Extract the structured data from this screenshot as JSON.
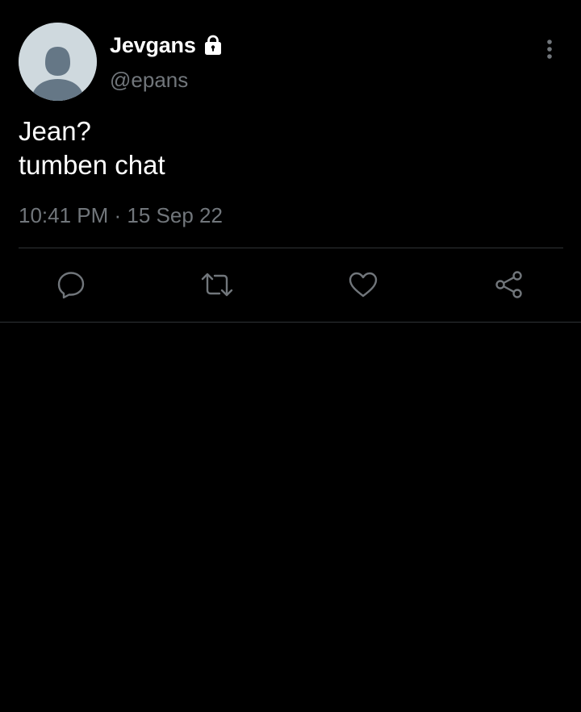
{
  "tweet": {
    "author": {
      "display_name": "Jevgans",
      "handle": "@epans",
      "protected_icon": "lock-icon",
      "avatar": "default-profile-avatar"
    },
    "text_lines": [
      "Jean?",
      "tumben chat"
    ],
    "timestamp": "10:41 PM · 15 Sep 22",
    "menu_icon": "more-vertical-icon",
    "actions": [
      {
        "name": "reply",
        "icon": "reply-bubble-icon"
      },
      {
        "name": "retweet",
        "icon": "retweet-icon"
      },
      {
        "name": "like",
        "icon": "heart-icon"
      },
      {
        "name": "share",
        "icon": "share-icon"
      }
    ]
  },
  "colors": {
    "background": "#000000",
    "primary_text": "#ffffff",
    "secondary_text": "#71767b",
    "icon": "#71767b",
    "divider": "#2f3336",
    "avatar_bg": "#cfd9de",
    "avatar_figure": "#657786"
  }
}
